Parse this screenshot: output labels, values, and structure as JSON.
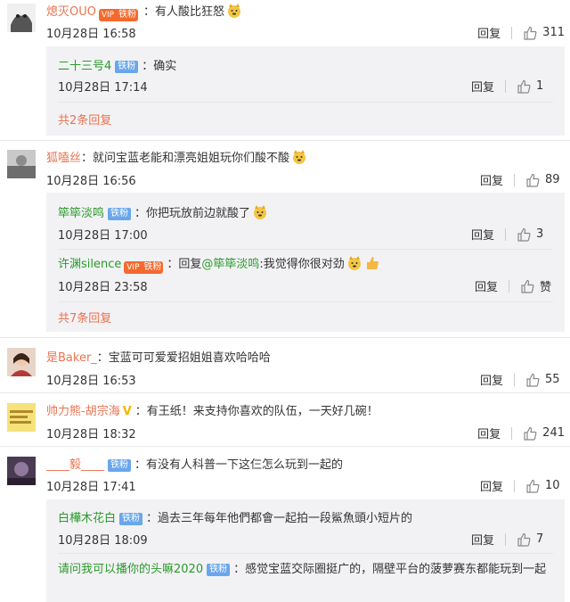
{
  "labels": {
    "reply": "回复",
    "tie_badge": "铁粉",
    "vip_badge": "V"
  },
  "colors": {
    "username": "#eb7350",
    "badge_blue": "#6aa7ea",
    "badge_orange": "#f46a2e",
    "reply_box": "#f2f2f5"
  },
  "comments": [
    {
      "username": "熄灭OUO",
      "text": "：有人酸比狂怒",
      "time": "10月28日 16:58",
      "likes": "311",
      "badge": "vip-tie",
      "emoji": "doge-icon",
      "replies": [
        {
          "username": "二十三号4",
          "badge": "铁粉",
          "text": "：确实",
          "time": "10月28日 17:14",
          "likes": "1"
        }
      ],
      "more_replies": "共2条回复"
    },
    {
      "username": "狐嗑丝",
      "text": "：就问宝蓝老能和漂亮姐姐玩你们酸不酸",
      "time": "10月28日 16:56",
      "likes": "89",
      "emoji": "doge-icon",
      "replies": [
        {
          "username": "筚筚淡鸣",
          "badge": "铁粉",
          "text": "：你把玩放前边就酸了",
          "time": "10月28日 17:00",
          "likes": "3"
        },
        {
          "username": "许渊silence",
          "badge": "vip-tie",
          "text_prefix": "：回复",
          "mention": "@筚筚淡鸣",
          "text": ":我觉得你很对劲",
          "time": "10月28日 23:58",
          "likes": "赞"
        }
      ],
      "more_replies": "共7条回复"
    },
    {
      "username": "是Baker_",
      "text": "：宝蓝可可爱爱招姐姐喜欢哈哈哈",
      "time": "10月28日 16:53",
      "likes": "55"
    },
    {
      "username": "帅力熊-胡宗海",
      "badge": "gold-v",
      "text": "：有王纸！来支持你喜欢的队伍，一天好几碗！",
      "time": "10月28日 18:32",
      "likes": "241"
    },
    {
      "username": "____毅____",
      "badge": "铁粉",
      "text": "：有没有人科普一下这仨怎么玩到一起的",
      "time": "10月28日 17:41",
      "likes": "10",
      "replies": [
        {
          "username": "白樺木花白",
          "badge": "铁粉",
          "text": "：過去三年每年他們都會一起拍一段鯊魚頭小短片的",
          "time": "10月28日 18:09",
          "likes": "7"
        },
        {
          "username": "请问我可以播你的头嘛2020",
          "badge": "铁粉",
          "text": "：感觉宝蓝交际圈挺广的，隔壁平台的菠萝赛东都能玩到一起"
        }
      ]
    }
  ]
}
